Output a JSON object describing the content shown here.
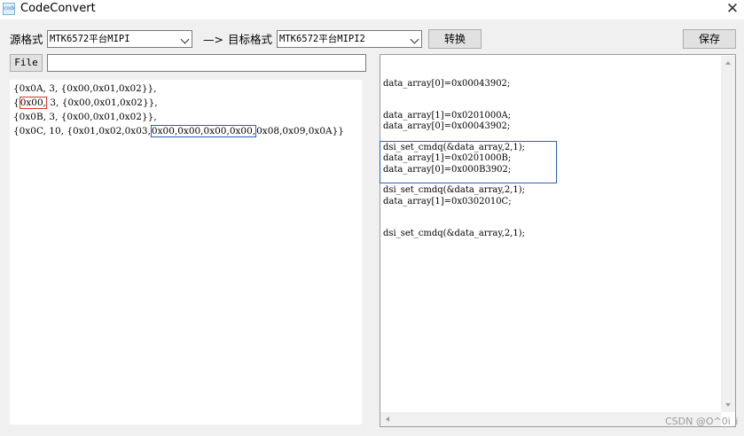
{
  "window": {
    "title": "CodeConvert",
    "close_glyph": "✕",
    "icon_text": "code"
  },
  "toolbar": {
    "source_format_label": "源格式",
    "source_format_value": "MTK6572平台MIPI",
    "arrow_label": "—>",
    "target_format_label": "目标格式",
    "target_format_value": "MTK6572平台MIPI2",
    "convert_label": "转换",
    "save_label": "保存"
  },
  "file": {
    "button_label": "File",
    "path_value": ""
  },
  "input_lines": [
    {
      "pre": "{0x0A, 3, {0x00,0x01,0x02}},"
    },
    {
      "hl": "0x00,",
      "post": " 3, {0x00,0x01,0x02}},"
    },
    {
      "pre": "{0x0B, 3, {0x00,0x01,0x02}},"
    },
    {
      "pre": "{0x0C, 10, {0x01,0x02,0x03,",
      "hl": "0x00,0x00,0x00,0x00,",
      "post": "0x08,0x09,0x0A}}"
    }
  ],
  "input_line2_prefix": "{",
  "output_blocks": [
    [
      "data_array[0]=0x00043902;",
      "data_array[1]=0x0201000A;",
      "dsi_set_cmdq(&data_array,2,1);"
    ],
    [
      "data_array[0]=0x00043902;",
      "data_array[1]=0x0201000B;",
      "dsi_set_cmdq(&data_array,2,1);"
    ],
    [
      "data_array[0]=0x000B3902;",
      "data_array[1]=0x0302010C;",
      "dsi_set_cmdq(&data_array,2,1);"
    ]
  ],
  "watermark": "CSDN @O^0i_i",
  "colors": {
    "highlight_red": "#e03030",
    "highlight_blue": "#2c5fbf"
  },
  "icons": {
    "app": "app-icon",
    "close": "close-icon",
    "dropdown": "chevron-down-icon",
    "scroll_up": "arrow-up-icon",
    "scroll_down": "arrow-down-icon",
    "scroll_left": "arrow-left-icon"
  }
}
